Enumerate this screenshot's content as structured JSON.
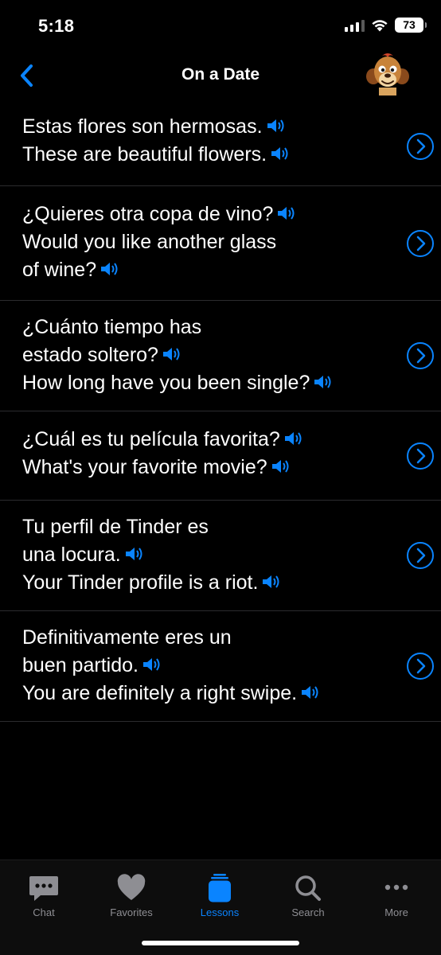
{
  "status_bar": {
    "time": "5:18",
    "battery": "73"
  },
  "nav": {
    "title": "On a Date"
  },
  "colors": {
    "accent": "#0a84ff",
    "background": "#000000",
    "separator": "#2b2b2e",
    "tab_inactive": "#8e8e93"
  },
  "phrases": [
    {
      "spanish": [
        "Estas flores son hermosas."
      ],
      "english": [
        "These are beautiful flowers."
      ]
    },
    {
      "spanish": [
        "¿Quieres otra copa de vino?"
      ],
      "english": [
        "Would you like another glass",
        "of wine?"
      ]
    },
    {
      "spanish": [
        "¿Cuánto tiempo has",
        "estado soltero?"
      ],
      "english": [
        "How long have you been single?"
      ]
    },
    {
      "spanish": [
        "¿Cuál es tu película favorita?"
      ],
      "english": [
        "What's your favorite movie?"
      ]
    },
    {
      "spanish": [
        "Tu perfil de Tinder es",
        "una locura."
      ],
      "english": [
        "Your Tinder profile is a riot."
      ]
    },
    {
      "spanish": [
        "Definitivamente eres un",
        "buen partido."
      ],
      "english": [
        "You are definitely a right swipe."
      ]
    }
  ],
  "tabs": [
    {
      "label": "Chat",
      "icon": "chat-bubble-icon",
      "active": false
    },
    {
      "label": "Favorites",
      "icon": "heart-icon",
      "active": false
    },
    {
      "label": "Lessons",
      "icon": "lessons-stack-icon",
      "active": true
    },
    {
      "label": "Search",
      "icon": "magnifier-icon",
      "active": false
    },
    {
      "label": "More",
      "icon": "ellipsis-icon",
      "active": false
    }
  ]
}
